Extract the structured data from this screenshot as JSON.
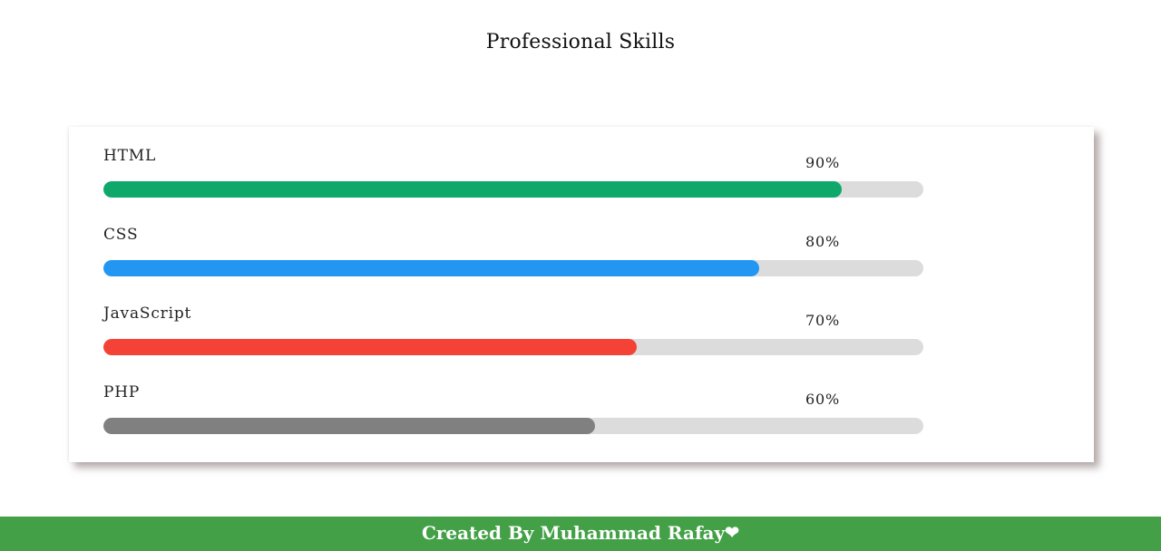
{
  "page": {
    "title": "Professional Skills"
  },
  "skills": [
    {
      "name": "HTML",
      "percent_label": "90%",
      "value": 0.9,
      "color": "#0ea86a"
    },
    {
      "name": "CSS",
      "percent_label": "80%",
      "value": 0.8,
      "color": "#2196f3"
    },
    {
      "name": "JavaScript",
      "percent_label": "70%",
      "value": 0.65,
      "color": "#f44336"
    },
    {
      "name": "PHP",
      "percent_label": "60%",
      "value": 0.6,
      "color": "#808080"
    }
  ],
  "footer": {
    "text": "Created By Muhammad Rafay",
    "icon": "heart-icon",
    "heart_glyph": "❤"
  },
  "colors": {
    "track": "#dcdcdc",
    "footer_bg": "#43a047"
  }
}
